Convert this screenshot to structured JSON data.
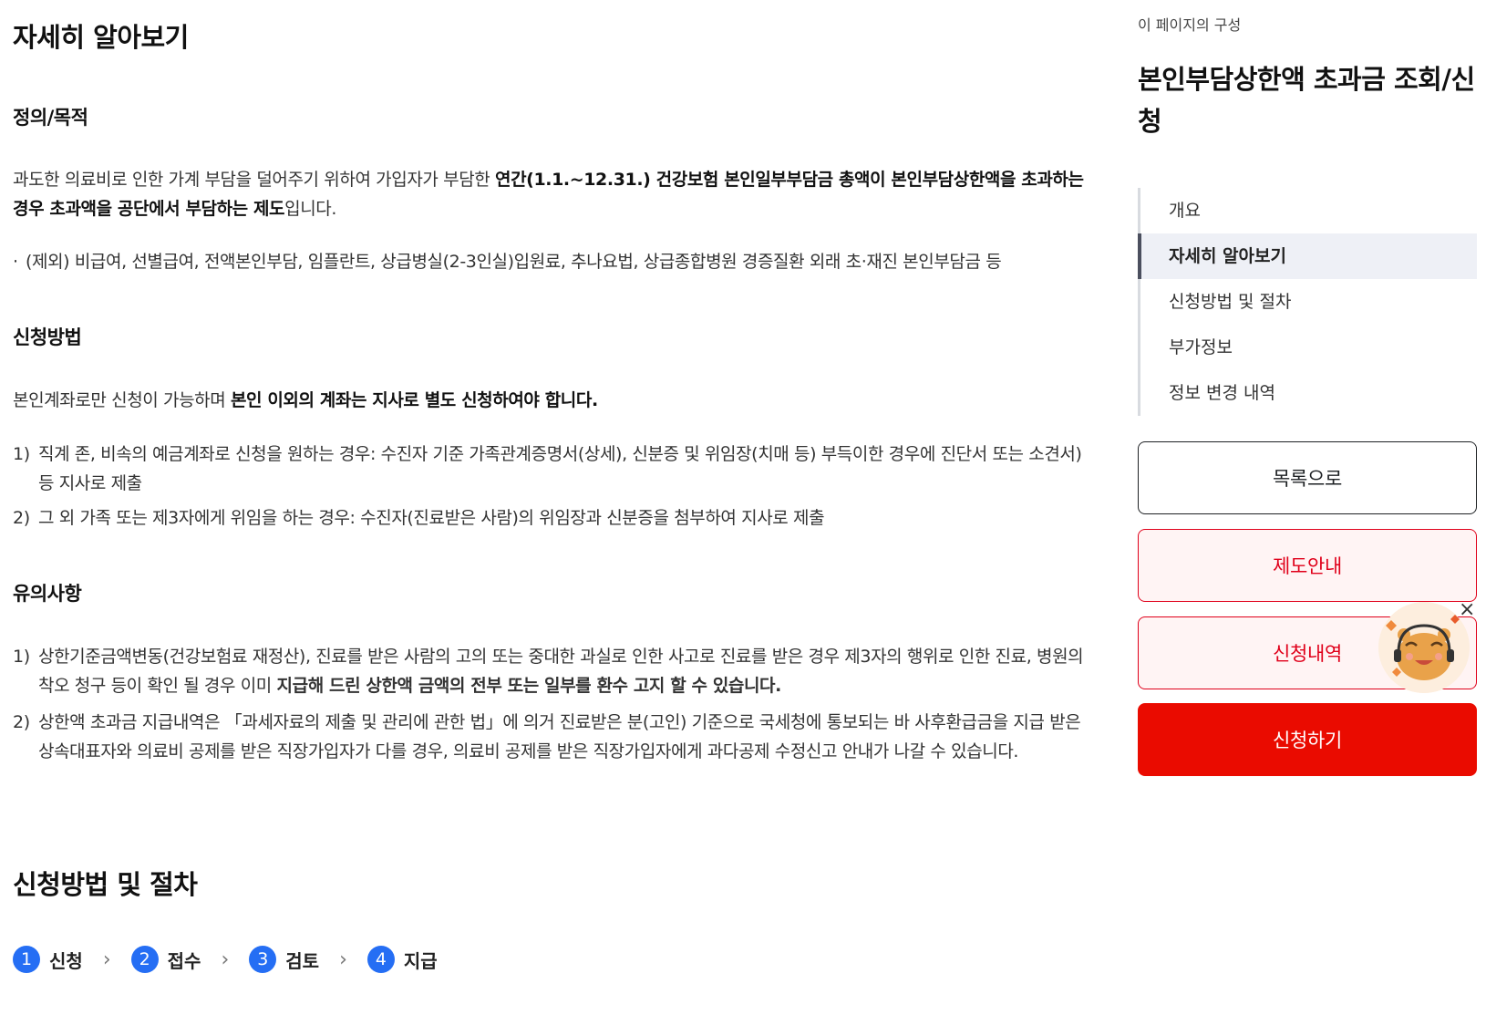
{
  "main": {
    "section_title": "자세히 알아보기",
    "definition": {
      "heading": "정의/목적",
      "text_pre": "과도한 의료비로 인한 가계 부담을 덜어주기 위하여 가입자가 부담한 ",
      "text_bold": "연간(1.1.~12.31.) 건강보험 본인일부부담금 총액이 본인부담상한액을 초과하는 경우 초과액을 공단에서 부담하는 제도",
      "text_post": "입니다.",
      "exclusion": "(제외) 비급여, 선별급여, 전액본인부담, 임플란트, 상급병실(2-3인실)입원료, 추나요법, 상급종합병원 경증질환 외래 초·재진 본인부담금 등"
    },
    "method": {
      "heading": "신청방법",
      "text_pre": "본인계좌로만 신청이 가능하며 ",
      "text_bold": "본인 이외의 계좌는 지사로 별도 신청하여야 합니다.",
      "items": [
        {
          "num": "1)",
          "text": "직계 존, 비속의 예금계좌로 신청을 원하는 경우: 수진자 기준 가족관계증명서(상세), 신분증 및 위임장(치매 등) 부득이한 경우에 진단서 또는 소견서) 등 지사로 제출"
        },
        {
          "num": "2)",
          "text": "그 외 가족 또는 제3자에게 위임을 하는 경우: 수진자(진료받은 사람)의 위임장과 신분증을 첨부하여 지사로 제출"
        }
      ]
    },
    "notes": {
      "heading": "유의사항",
      "item1_num": "1)",
      "item1_pre": "상한기준금액변동(건강보험료 재정산), 진료를 받은 사람의 고의 또는 중대한 과실로 인한 사고로 진료를 받은 경우 제3자의 행위로 인한 진료, 병원의 착오 청구 등이 확인 될 경우 이미 ",
      "item1_bold": "지급해 드린 상한액 금액의 전부 또는 일부를 환수 고지 할 수 있습니다.",
      "item2_num": "2)",
      "item2_text": "상한액 초과금 지급내역은 「과세자료의 제출 및 관리에 관한 법」에 의거 진료받은 분(고인) 기준으로 국세청에 통보되는 바 사후환급금을 지급 받은 상속대표자와 의료비 공제를 받은 직장가입자가 다를 경우, 의료비 공제를 받은 직장가입자에게 과다공제 수정신고 안내가 나갈 수 있습니다."
    },
    "procedure_title": "신청방법 및 절차",
    "steps": [
      {
        "num": "1",
        "label": "신청"
      },
      {
        "num": "2",
        "label": "접수"
      },
      {
        "num": "3",
        "label": "검토"
      },
      {
        "num": "4",
        "label": "지급"
      }
    ],
    "step_arrow": "›"
  },
  "sidebar": {
    "caption": "이 페이지의 구성",
    "title": "본인부담상한액 초과금 조회/신청",
    "toc": [
      {
        "label": "개요",
        "active": false
      },
      {
        "label": "자세히 알아보기",
        "active": true
      },
      {
        "label": "신청방법 및 절차",
        "active": false
      },
      {
        "label": "부가정보",
        "active": false
      },
      {
        "label": "정보 변경 내역",
        "active": false
      }
    ],
    "buttons": {
      "list": "목록으로",
      "guide": "제도안내",
      "history": "신청내역",
      "apply": "신청하기"
    },
    "close_icon": "×"
  },
  "colors": {
    "accent_blue": "#256ef4",
    "brand_red": "#ea0b00",
    "pink_bg": "#fff4f4"
  }
}
